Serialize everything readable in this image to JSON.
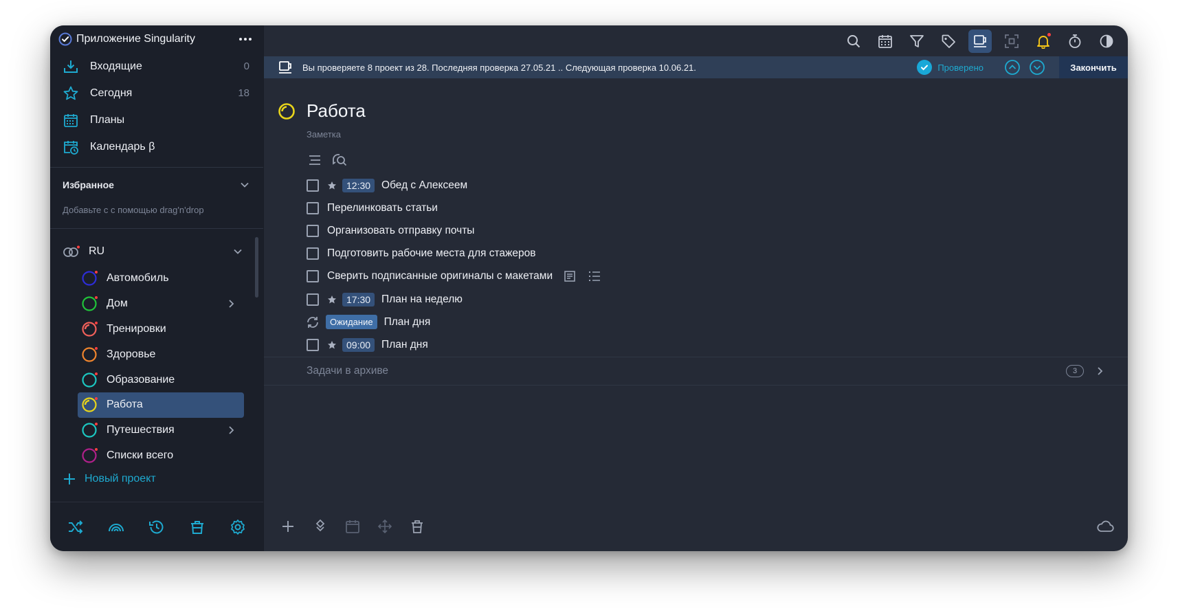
{
  "app": {
    "title": "Приложение Singularity"
  },
  "nav": [
    {
      "label": "Входящие",
      "count": "0",
      "icon": "inbox-icon"
    },
    {
      "label": "Сегодня",
      "count": "18",
      "icon": "star-icon"
    },
    {
      "label": "Планы",
      "count": "",
      "icon": "calendar-icon"
    },
    {
      "label": "Календарь β",
      "count": "",
      "icon": "calendar-clock-icon"
    }
  ],
  "favorites": {
    "label": "Избранное",
    "hint": "Добавьте с с помощью drag'n'drop"
  },
  "group": {
    "label": "RU"
  },
  "projects": [
    {
      "label": "Автомобиль",
      "color": "#2d2dd6",
      "has_children": false,
      "active": false
    },
    {
      "label": "Дом",
      "color": "#21c43a",
      "has_children": true,
      "active": false
    },
    {
      "label": "Тренировки",
      "color": "#f0605a",
      "has_children": false,
      "active": false
    },
    {
      "label": "Здоровье",
      "color": "#f0852d",
      "has_children": false,
      "active": false
    },
    {
      "label": "Образование",
      "color": "#1cc6c0",
      "has_children": false,
      "active": false
    },
    {
      "label": "Работа",
      "color": "#e8d41b",
      "has_children": false,
      "active": true
    },
    {
      "label": "Путешествия",
      "color": "#1cc6c0",
      "has_children": true,
      "active": false
    },
    {
      "label": "Списки всего",
      "color": "#b0208a",
      "has_children": false,
      "active": false
    }
  ],
  "new_project_label": "Новый проект",
  "review": {
    "text": "Вы проверяете 8 проект из 28. Последняя проверка 27.05.21 .. Следующая проверка 10.06.21.",
    "checked_label": "Проверено",
    "finish_label": "Закончить"
  },
  "project": {
    "title": "Работа",
    "note_label": "Заметка",
    "color": "#e8d41b"
  },
  "tasks": [
    {
      "title": "Обед с Алексеем",
      "starred": true,
      "time": "12:30",
      "status": "",
      "repeat": false,
      "extras": false
    },
    {
      "title": "Перелинковать статьи",
      "starred": false,
      "time": "",
      "status": "",
      "repeat": false,
      "extras": false
    },
    {
      "title": "Организовать отправку почты",
      "starred": false,
      "time": "",
      "status": "",
      "repeat": false,
      "extras": false
    },
    {
      "title": "Подготовить рабочие места для стажеров",
      "starred": false,
      "time": "",
      "status": "",
      "repeat": false,
      "extras": false
    },
    {
      "title": "Сверить подписанные оригиналы с макетами",
      "starred": false,
      "time": "",
      "status": "",
      "repeat": false,
      "extras": true
    },
    {
      "title": "План на неделю",
      "starred": true,
      "time": "17:30",
      "status": "",
      "repeat": false,
      "extras": false
    },
    {
      "title": "План дня",
      "starred": false,
      "time": "",
      "status": "Ожидание",
      "repeat": true,
      "extras": false
    },
    {
      "title": "План дня",
      "starred": true,
      "time": "09:00",
      "status": "",
      "repeat": false,
      "extras": false
    }
  ],
  "archive": {
    "label": "Задачи в архиве",
    "count": "3"
  },
  "colors": {
    "accent": "#1eaad0",
    "bg": "#252a36",
    "sidebar": "#1b1f29",
    "active": "#34517a",
    "bell": "#f5c518"
  }
}
